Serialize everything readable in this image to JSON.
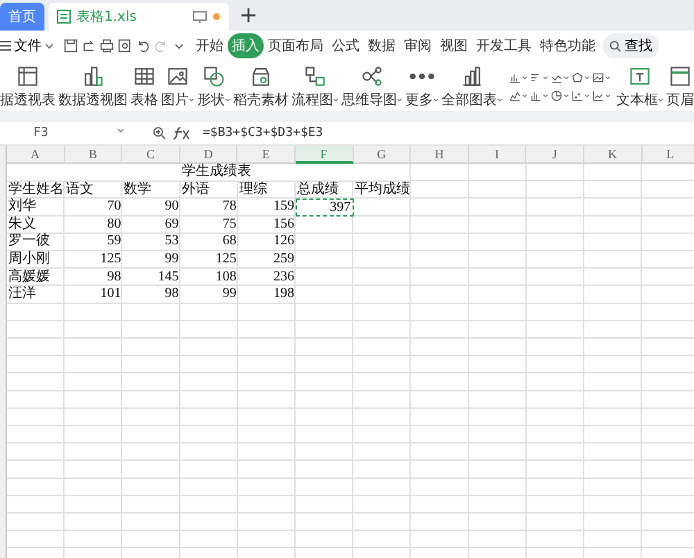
{
  "tabs": [
    {
      "label": "首页",
      "selected": false
    },
    {
      "label": "表格1.xls",
      "selected": true
    }
  ],
  "menu": {
    "file": "文件",
    "items": [
      {
        "label": "开始",
        "selected": false
      },
      {
        "label": "插入",
        "selected": true
      },
      {
        "label": "页面布局",
        "selected": false
      },
      {
        "label": "公式",
        "selected": false
      },
      {
        "label": "数据",
        "selected": false
      },
      {
        "label": "审阅",
        "selected": false
      },
      {
        "label": "视图",
        "selected": false
      },
      {
        "label": "开发工具",
        "selected": false
      },
      {
        "label": "特色功能",
        "selected": false
      }
    ],
    "search": "查找"
  },
  "ribbon": [
    {
      "kind": "pivot-table",
      "label": "据透视表",
      "dropdown": false
    },
    {
      "kind": "pivot-chart",
      "label": "数据透视图",
      "dropdown": false
    },
    {
      "kind": "table",
      "label": "表格",
      "dropdown": false
    },
    {
      "kind": "picture",
      "label": "图片",
      "dropdown": true
    },
    {
      "kind": "shape",
      "label": "形状",
      "dropdown": true
    },
    {
      "kind": "store",
      "label": "稻壳素材",
      "dropdown": false
    },
    {
      "kind": "flow",
      "label": "流程图",
      "dropdown": true
    },
    {
      "kind": "mindmap",
      "label": "思维导图",
      "dropdown": true
    },
    {
      "kind": "more",
      "label": "更多",
      "dropdown": true
    },
    {
      "kind": "chart",
      "label": "全部图表",
      "dropdown": true
    },
    {
      "kind": "chart-grid"
    },
    {
      "kind": "textbox",
      "label": "文本框",
      "dropdown": true
    },
    {
      "kind": "header",
      "label": "页眉",
      "dropdown": false
    }
  ],
  "formula_bar": {
    "cell_ref": "F3",
    "formula": "=$B3+$C3+$D3+$E3"
  },
  "sheet": {
    "columns": [
      {
        "label": "A",
        "selected": false
      },
      {
        "label": "B",
        "selected": false
      },
      {
        "label": "C",
        "selected": false
      },
      {
        "label": "D",
        "selected": false
      },
      {
        "label": "E",
        "selected": false
      },
      {
        "label": "F",
        "selected": true
      },
      {
        "label": "G",
        "selected": false
      },
      {
        "label": "H",
        "selected": false
      },
      {
        "label": "I",
        "selected": false
      },
      {
        "label": "J",
        "selected": false
      },
      {
        "label": "K",
        "selected": false
      },
      {
        "label": "L",
        "selected": false
      }
    ],
    "rows": [
      {
        "kind": "title",
        "cells": [
          "",
          "",
          "",
          "学生成绩表"
        ]
      },
      {
        "kind": "header",
        "cells": [
          "学生姓名",
          "语文",
          "数学",
          "外语",
          "理综",
          "总成绩",
          "平均成绩"
        ]
      },
      {
        "kind": "data",
        "cells": [
          "刘华",
          "70",
          "90",
          "78",
          "159",
          {
            "text": "397",
            "selected": true
          }
        ]
      },
      {
        "kind": "data",
        "cells": [
          "朱义",
          "80",
          "69",
          "75",
          "156"
        ]
      },
      {
        "kind": "data",
        "cells": [
          "罗一彼",
          "59",
          "53",
          "68",
          "126"
        ]
      },
      {
        "kind": "data",
        "cells": [
          "周小刚",
          "125",
          "99",
          "125",
          "259"
        ]
      },
      {
        "kind": "data",
        "cells": [
          "高媛媛",
          "98",
          "145",
          "108",
          "236"
        ]
      },
      {
        "kind": "data",
        "cells": [
          "汪洋",
          "101",
          "98",
          "99",
          "198"
        ]
      }
    ]
  }
}
